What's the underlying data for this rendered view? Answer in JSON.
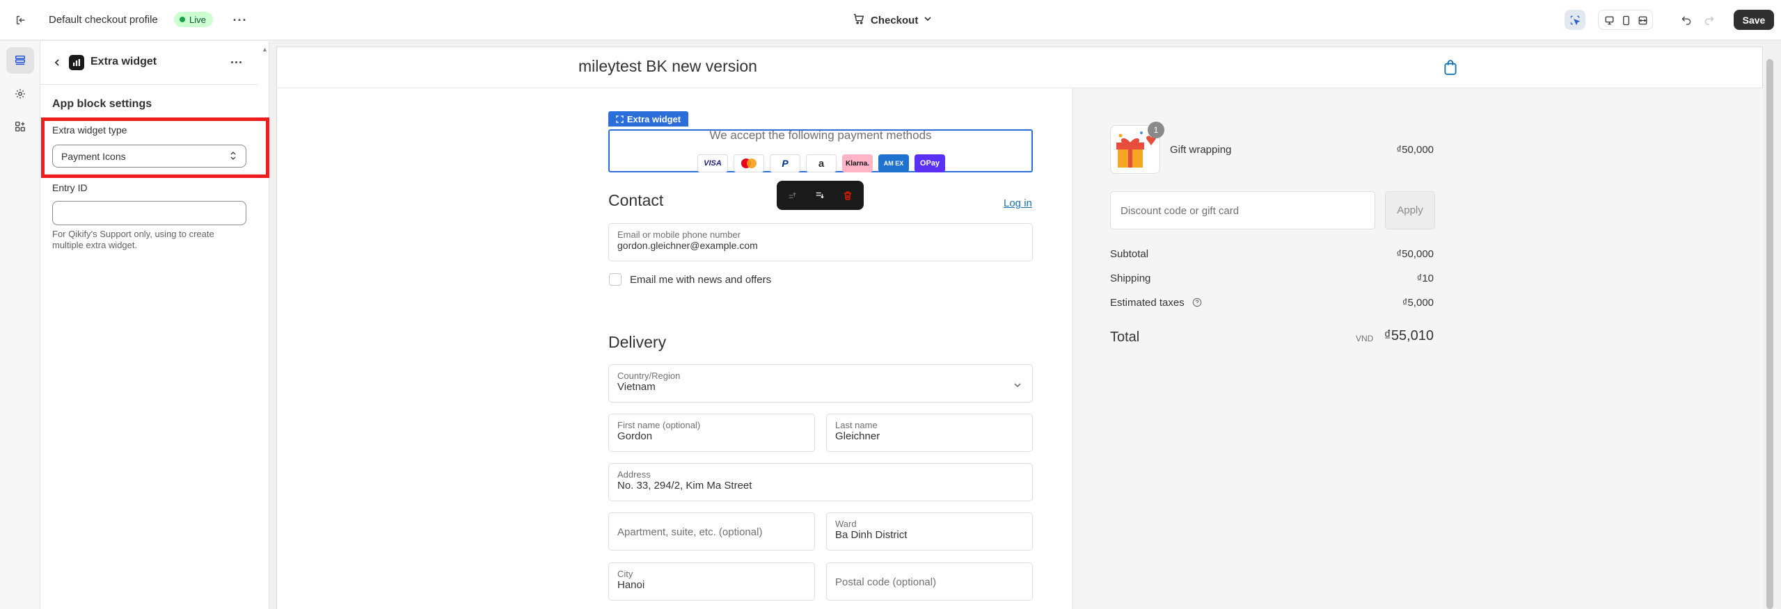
{
  "topbar": {
    "profile_name": "Default checkout profile",
    "live_badge": "Live",
    "page_selector": "Checkout",
    "save_label": "Save"
  },
  "panel": {
    "title": "Extra widget",
    "section_title": "App block settings",
    "widget_type_label": "Extra widget type",
    "widget_type_value": "Payment Icons",
    "entry_id_label": "Entry ID",
    "entry_id_value": "",
    "help_text": "For Qikify's Support only, using to create multiple extra widget."
  },
  "store": {
    "name": "mileytest BK new version"
  },
  "widget": {
    "tag_label": "Extra widget",
    "heading": "We accept the following payment methods",
    "payment_icons": [
      "VISA",
      "Mastercard",
      "PayPal",
      "Amazon",
      "Klarna.",
      "AMEX",
      "OPay"
    ]
  },
  "contact": {
    "heading": "Contact",
    "login_link": "Log in",
    "email_label": "Email or mobile phone number",
    "email_value": "gordon.gleichner@example.com",
    "newsletter_label": "Email me with news and offers"
  },
  "delivery": {
    "heading": "Delivery",
    "country_label": "Country/Region",
    "country_value": "Vietnam",
    "first_name_label": "First name (optional)",
    "first_name_value": "Gordon",
    "last_name_label": "Last name",
    "last_name_value": "Gleichner",
    "address_label": "Address",
    "address_value": "No. 33, 294/2, Kim Ma Street",
    "apartment_placeholder": "Apartment, suite, etc. (optional)",
    "ward_label": "Ward",
    "ward_value": "Ba Dinh District",
    "city_label": "City",
    "city_value": "Hanoi",
    "postal_placeholder": "Postal code (optional)"
  },
  "summary": {
    "item_name": "Gift wrapping",
    "item_price": "₫50,000",
    "item_qty": "1",
    "discount_placeholder": "Discount code or gift card",
    "apply_label": "Apply",
    "subtotal_label": "Subtotal",
    "subtotal_value": "₫50,000",
    "shipping_label": "Shipping",
    "shipping_value": "₫10",
    "taxes_label": "Estimated taxes",
    "taxes_value": "₫5,000",
    "total_label": "Total",
    "total_currency": "VND",
    "total_value": "₫55,010"
  }
}
